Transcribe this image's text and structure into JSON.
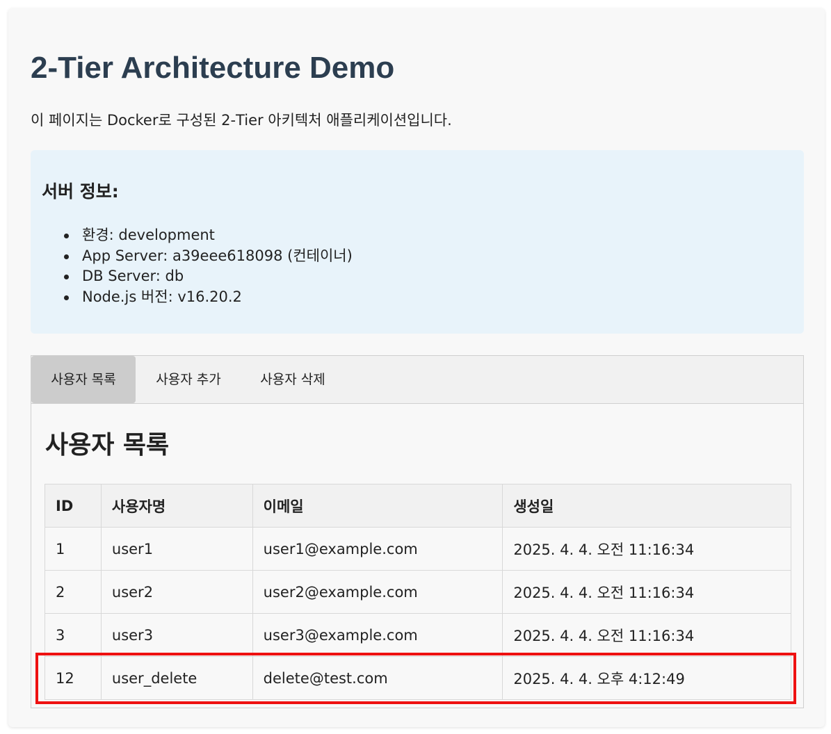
{
  "page": {
    "title": "2-Tier Architecture Demo",
    "description": "이 페이지는 Docker로 구성된 2-Tier 아키텍처 애플리케이션입니다."
  },
  "server_info": {
    "title": "서버 정보:",
    "items": [
      "환경: development",
      "App Server: a39eee618098 (컨테이너)",
      "DB Server: db",
      "Node.js 버전: v16.20.2"
    ]
  },
  "tabs": [
    {
      "label": "사용자 목록",
      "active": true
    },
    {
      "label": "사용자 추가",
      "active": false
    },
    {
      "label": "사용자 삭제",
      "active": false
    }
  ],
  "user_list": {
    "title": "사용자 목록",
    "columns": [
      "ID",
      "사용자명",
      "이메일",
      "생성일"
    ],
    "rows": [
      [
        "1",
        "user1",
        "user1@example.com",
        "2025. 4. 4. 오전 11:16:34"
      ],
      [
        "2",
        "user2",
        "user2@example.com",
        "2025. 4. 4. 오전 11:16:34"
      ],
      [
        "3",
        "user3",
        "user3@example.com",
        "2025. 4. 4. 오전 11:16:34"
      ],
      [
        "12",
        "user_delete",
        "delete@test.com",
        "2025. 4. 4. 오후 4:12:49"
      ]
    ],
    "highlighted_row": 3
  },
  "colors": {
    "title": "#2c3e50",
    "info_background": "#e8f3fa",
    "active_tab": "#cccccc",
    "highlight_border": "#ee1111"
  }
}
